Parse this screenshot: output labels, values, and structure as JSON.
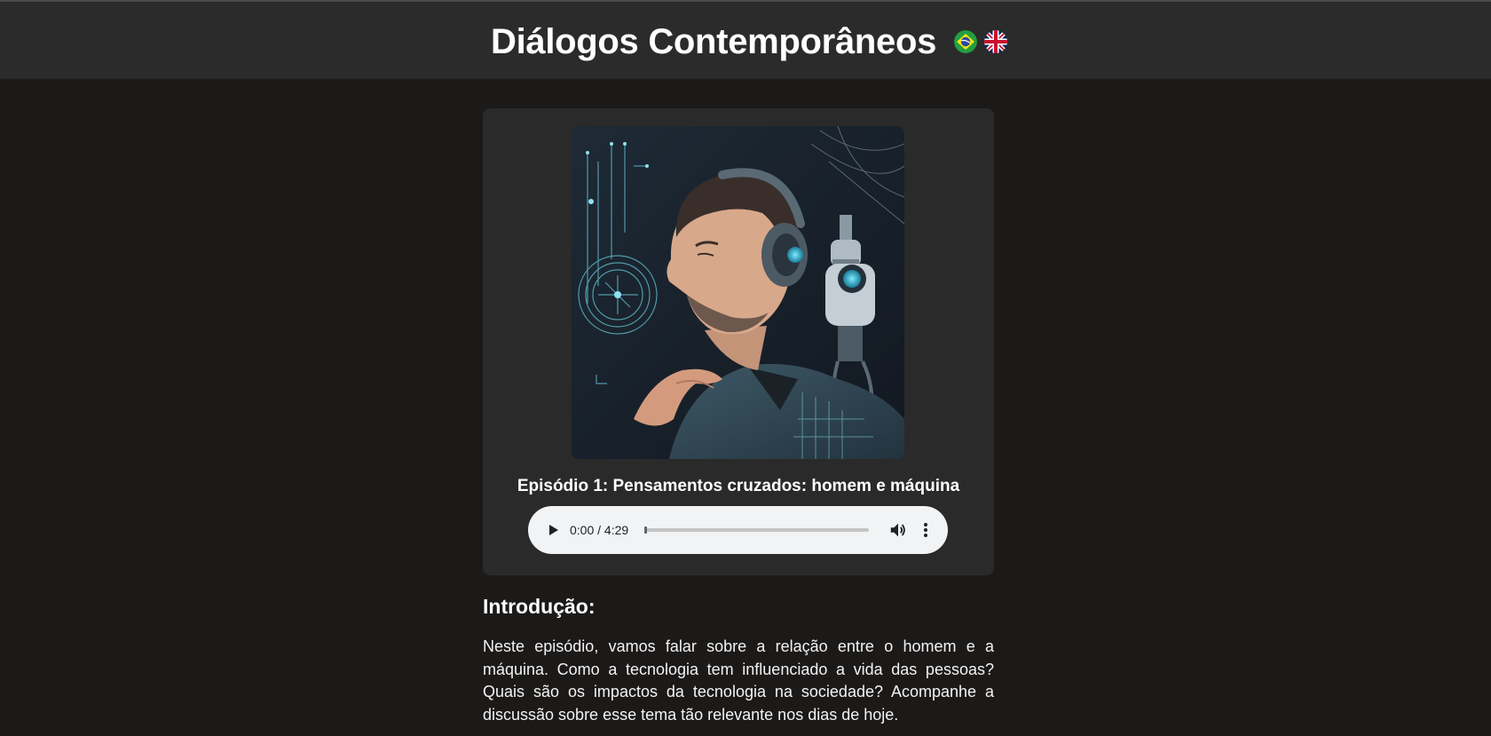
{
  "header": {
    "title": "Diálogos Contemporâneos",
    "languages": [
      {
        "code": "pt-BR",
        "icon": "brazil-flag-icon"
      },
      {
        "code": "en-GB",
        "icon": "uk-flag-icon"
      }
    ]
  },
  "episode": {
    "cover_icon": "podcast-cover-image",
    "title": "Episódio 1: Pensamentos cruzados: homem e máquina",
    "player": {
      "time": "0:00 / 4:29",
      "progress": 0.0,
      "play_icon": "play-icon",
      "volume_icon": "volume-icon",
      "more_icon": "more-options-icon"
    }
  },
  "intro": {
    "heading": "Introdução:",
    "text": "Neste episódio, vamos falar sobre a relação entre o homem e a máquina. Como a tecnologia tem influenciado a vida das pessoas? Quais são os impactos da tecnologia na sociedade? Acompanhe a discussão sobre esse tema tão relevante nos dias de hoje."
  },
  "colors": {
    "page_bg": "#1c1a19",
    "header_bg": "#2b2b2b",
    "card_bg": "#2a2a2a",
    "player_bg": "#f1f3f4"
  }
}
